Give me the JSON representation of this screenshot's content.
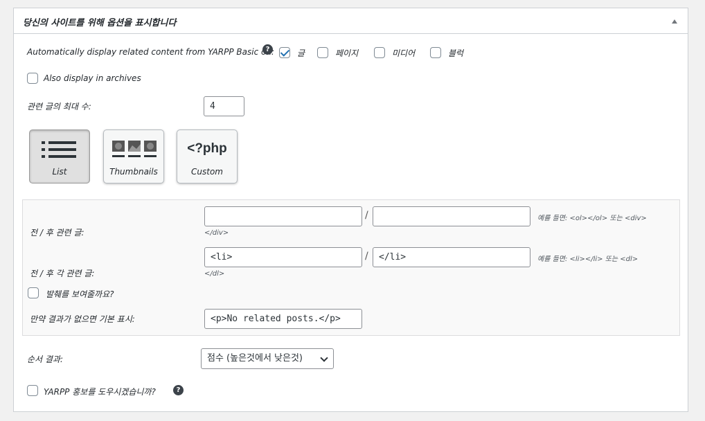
{
  "title": "당신의 사이트를 위해 옵션을 표시합니다",
  "auto_display": {
    "label": "Automatically display related content from YARPP Basic on:",
    "help_icon": "question-circle-icon",
    "options": [
      {
        "label": "글",
        "checked": true
      },
      {
        "label": "페이지",
        "checked": false
      },
      {
        "label": "미디어",
        "checked": false
      },
      {
        "label": "블럭",
        "checked": false
      }
    ]
  },
  "archives": {
    "label": "Also display in archives",
    "checked": false
  },
  "max_related": {
    "label": "관련 글의 최대 수:",
    "value": "4"
  },
  "templates": [
    {
      "label": "List",
      "icon": "list-icon",
      "selected": true
    },
    {
      "label": "Thumbnails",
      "icon": "thumbnails-icon",
      "selected": false
    },
    {
      "label": "Custom",
      "icon": "php-code-icon",
      "icon_text": "<?php",
      "selected": false
    }
  ],
  "wrap_related": {
    "label": "전 / 후 관련 글:",
    "before_value": "",
    "after_value": "",
    "hint": "예를 들면: <ol></ol> 또는 <div>",
    "hint2": "</div>"
  },
  "wrap_each": {
    "label": "전 / 후 각 관련 글:",
    "before_value": "<li>",
    "after_value": "</li>",
    "hint": "예를 들면: <li></li> 또는 <dl>",
    "hint2": "</dl>"
  },
  "separator": "/",
  "excerpt": {
    "label": "발췌를 보여줄까요?",
    "checked": false
  },
  "no_results": {
    "label": "만약 결과가 없으면 기본 표시:",
    "value": "<p>No related posts.</p>"
  },
  "order": {
    "label": "순서 결과:",
    "value": "점수 (높은것에서 낮은것)"
  },
  "promote": {
    "label": "YARPP 홍보를 도우시겠습니까?",
    "checked": false,
    "help_icon": "question-circle-icon"
  }
}
